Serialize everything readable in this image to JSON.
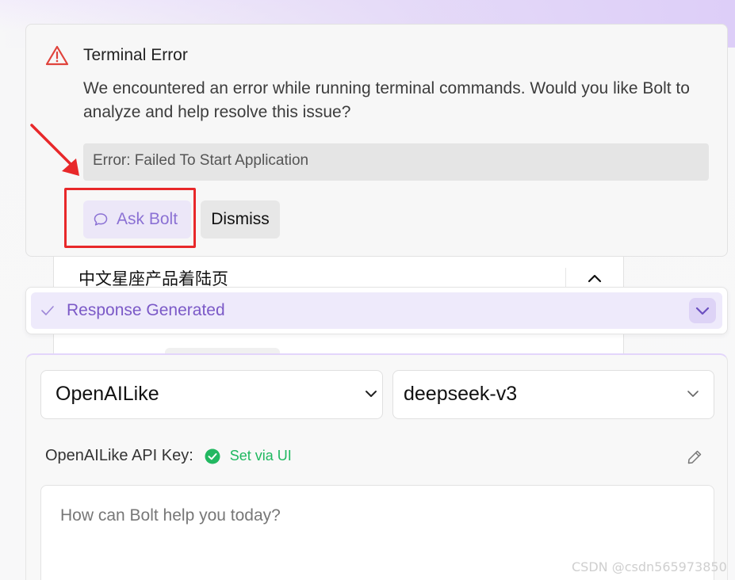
{
  "error_card": {
    "icon": "warning-triangle-icon",
    "title": "Terminal Error",
    "description": "We encountered an error while running terminal commands. Would you like Bolt to analyze and help resolve this issue?",
    "error_message": "Error: Failed To Start Application",
    "ask_button": "Ask Bolt",
    "ask_icon": "chat-bubble-icon",
    "dismiss_button": "Dismiss",
    "annotation_color": "#e8282a"
  },
  "background_panel": {
    "title": "中文星座产品着陆页",
    "icon": "chevron-up-icon"
  },
  "response_bar": {
    "icon": "check-icon",
    "label": "Response Generated",
    "toggle_icon": "chevron-down-icon",
    "accent": "#7b59c7"
  },
  "chat": {
    "provider_select": "OpenAILike",
    "model_select": "deepseek-v3",
    "api_key_label": "OpenAILike API Key:",
    "api_key_status": "Set via UI",
    "api_status_color": "#1fb860",
    "edit_icon": "pencil-icon",
    "prompt_placeholder": "How can Bolt help you today?"
  },
  "watermark": "CSDN @csdn565973850"
}
